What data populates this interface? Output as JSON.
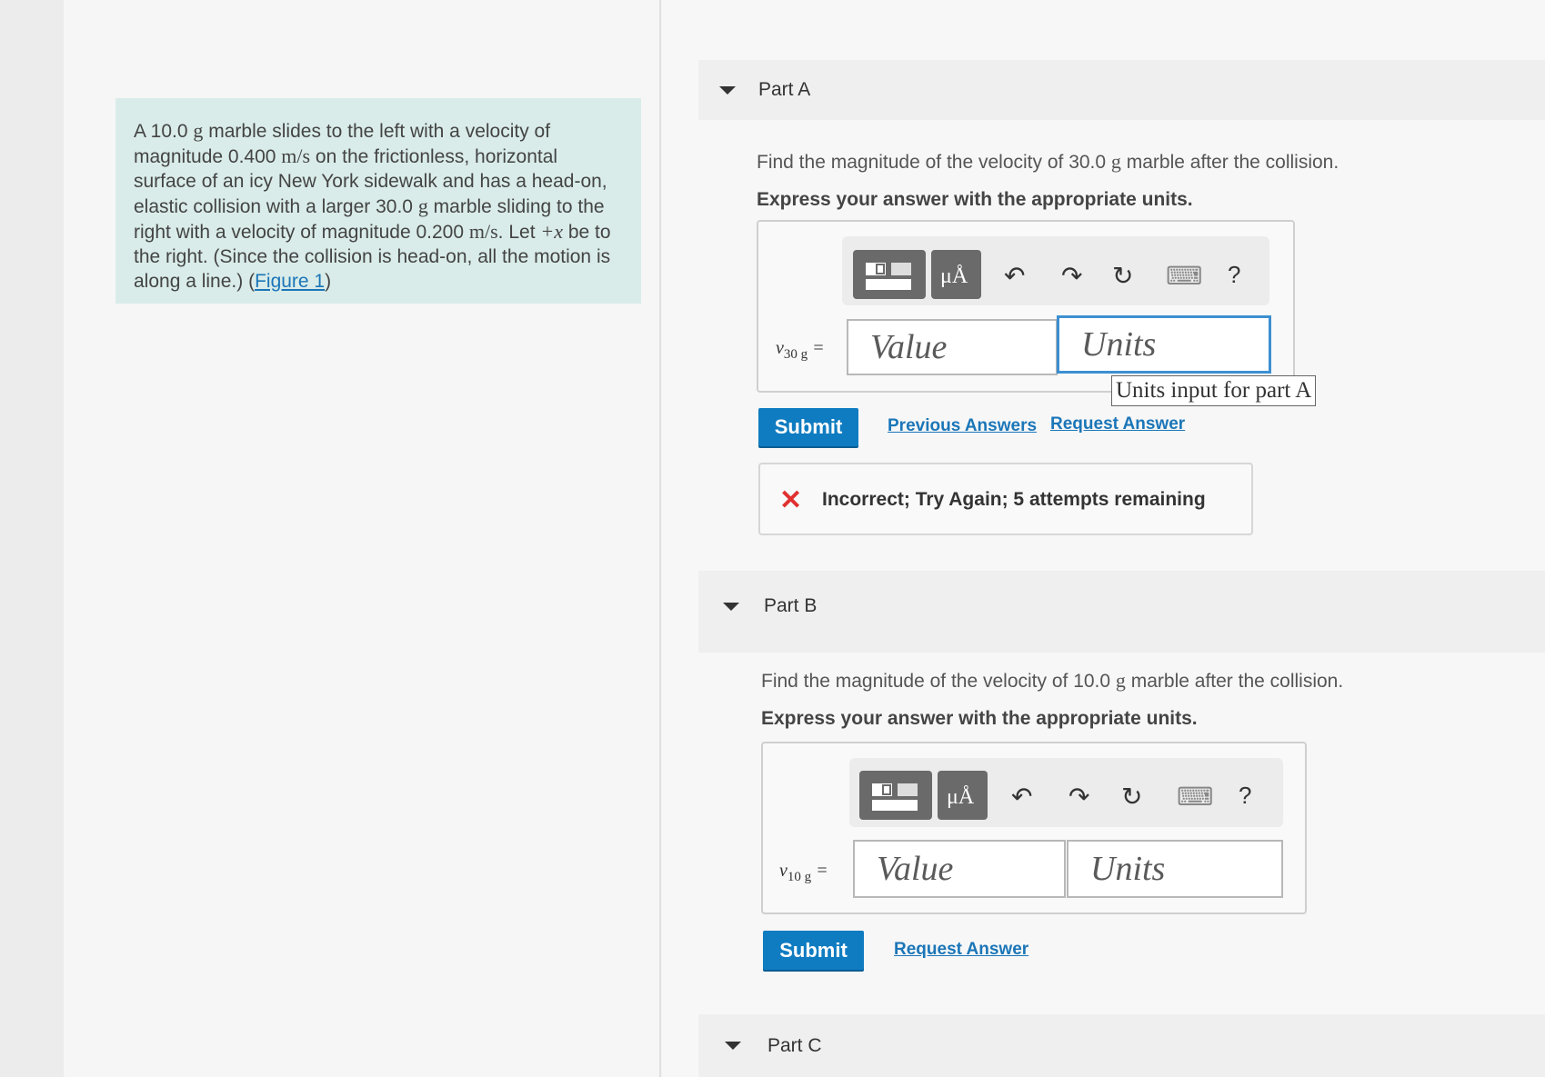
{
  "problem": {
    "t1": "A 10.0 ",
    "u1": "g",
    "t2": " marble slides to the left with a velocity of magnitude 0.400 ",
    "u2": "m/s",
    "t3": " on the frictionless, horizontal surface of an icy New York sidewalk and has a head-on, elastic collision with a larger 30.0 ",
    "u3": "g",
    "t4": " marble sliding to the right with a velocity of magnitude 0.200 ",
    "u4": "m/s",
    "t5": ". Let ",
    "var": "+x",
    "t6": " be to the right. (Since the collision is head-on, all the motion is along a line.) (",
    "figure_link": "Figure 1",
    "t7": ")"
  },
  "partA": {
    "title": "Part A",
    "question_pre": "Find the magnitude of the velocity of 30.0 ",
    "question_unit": "g",
    "question_post": " marble after the collision.",
    "instruction": "Express your answer with the appropriate units.",
    "var_main": "v",
    "var_sub": "30 g",
    "equals": "=",
    "value_placeholder": "Value",
    "units_placeholder": "Units",
    "tooltip": "Units input for part A",
    "submit": "Submit",
    "previous_answers": "Previous Answers",
    "request_answer": "Request Answer",
    "feedback_icon": "✕",
    "feedback": "Incorrect; Try Again; 5 attempts remaining"
  },
  "partB": {
    "title": "Part B",
    "question_pre": "Find the magnitude of the velocity of 10.0 ",
    "question_unit": "g",
    "question_post": " marble after the collision.",
    "instruction": "Express your answer with the appropriate units.",
    "var_main": "v",
    "var_sub": "10 g",
    "equals": "=",
    "value_placeholder": "Value",
    "units_placeholder": "Units",
    "submit": "Submit",
    "request_answer": "Request Answer"
  },
  "partC": {
    "title": "Part C"
  },
  "toolbar": {
    "templates_icon": "templates-icon",
    "units_icon": "units-icon",
    "units_glyph": "μÅ",
    "undo": "↶",
    "redo": "↷",
    "reset": "↻",
    "keyboard": "⌨",
    "help": "?"
  }
}
